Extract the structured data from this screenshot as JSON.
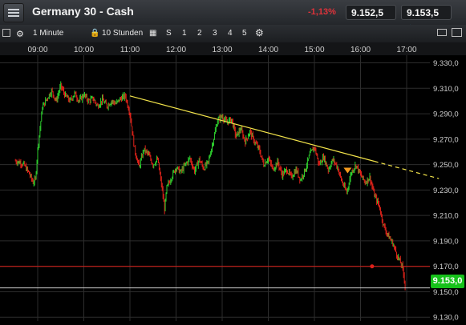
{
  "header": {
    "title": "Germany 30 - Cash",
    "change": "-1,13%",
    "sell_price": "9.152,5",
    "buy_price": "9.153,5"
  },
  "toolbar": {
    "interval": "1 Minute",
    "range": "10 Stunden",
    "s_label": "S",
    "presets": [
      "1",
      "2",
      "3",
      "4",
      "5"
    ]
  },
  "current_price": "9.153,0",
  "chart_data": {
    "type": "candlestick",
    "x_tick_labels": [
      "09:00",
      "10:00",
      "11:00",
      "12:00",
      "13:00",
      "14:00",
      "15:00",
      "16:00",
      "17:00"
    ],
    "y_tick_labels": [
      "9.330,0",
      "9.310,0",
      "9.290,0",
      "9.270,0",
      "9.250,0",
      "9.230,0",
      "9.210,0",
      "9.190,0",
      "9.170,0",
      "9.150,0",
      "9.130,0"
    ],
    "y_ticks": [
      9330,
      9310,
      9290,
      9270,
      9250,
      9230,
      9210,
      9190,
      9170,
      9150,
      9130
    ],
    "ylim": [
      9127,
      9336
    ],
    "x_hours": [
      9,
      10,
      11,
      12,
      13,
      14,
      15,
      16,
      17
    ],
    "price_path": [
      [
        8.5,
        9253
      ],
      [
        8.6,
        9252
      ],
      [
        8.7,
        9250
      ],
      [
        8.8,
        9244
      ],
      [
        8.9,
        9236
      ],
      [
        8.95,
        9238
      ],
      [
        9.0,
        9262
      ],
      [
        9.1,
        9295
      ],
      [
        9.2,
        9302
      ],
      [
        9.3,
        9308
      ],
      [
        9.4,
        9300
      ],
      [
        9.5,
        9312
      ],
      [
        9.6,
        9304
      ],
      [
        9.7,
        9300
      ],
      [
        9.8,
        9306
      ],
      [
        9.9,
        9300
      ],
      [
        10.0,
        9305
      ],
      [
        10.1,
        9300
      ],
      [
        10.2,
        9302
      ],
      [
        10.3,
        9296
      ],
      [
        10.4,
        9301
      ],
      [
        10.5,
        9296
      ],
      [
        10.6,
        9300
      ],
      [
        10.7,
        9298
      ],
      [
        10.8,
        9302
      ],
      [
        10.9,
        9304
      ],
      [
        11.0,
        9290
      ],
      [
        11.1,
        9262
      ],
      [
        11.2,
        9248
      ],
      [
        11.3,
        9262
      ],
      [
        11.4,
        9258
      ],
      [
        11.5,
        9250
      ],
      [
        11.6,
        9254
      ],
      [
        11.7,
        9230
      ],
      [
        11.75,
        9215
      ],
      [
        11.8,
        9232
      ],
      [
        11.9,
        9240
      ],
      [
        12.0,
        9248
      ],
      [
        12.1,
        9244
      ],
      [
        12.2,
        9250
      ],
      [
        12.3,
        9255
      ],
      [
        12.4,
        9245
      ],
      [
        12.5,
        9254
      ],
      [
        12.6,
        9247
      ],
      [
        12.7,
        9252
      ],
      [
        12.8,
        9268
      ],
      [
        12.9,
        9285
      ],
      [
        13.0,
        9288
      ],
      [
        13.1,
        9283
      ],
      [
        13.2,
        9286
      ],
      [
        13.3,
        9272
      ],
      [
        13.4,
        9278
      ],
      [
        13.5,
        9268
      ],
      [
        13.6,
        9276
      ],
      [
        13.7,
        9268
      ],
      [
        13.8,
        9262
      ],
      [
        13.9,
        9250
      ],
      [
        14.0,
        9255
      ],
      [
        14.1,
        9246
      ],
      [
        14.2,
        9252
      ],
      [
        14.3,
        9242
      ],
      [
        14.4,
        9246
      ],
      [
        14.5,
        9240
      ],
      [
        14.6,
        9246
      ],
      [
        14.7,
        9238
      ],
      [
        14.8,
        9246
      ],
      [
        14.9,
        9258
      ],
      [
        15.0,
        9264
      ],
      [
        15.1,
        9250
      ],
      [
        15.2,
        9256
      ],
      [
        15.3,
        9246
      ],
      [
        15.4,
        9254
      ],
      [
        15.5,
        9248
      ],
      [
        15.6,
        9236
      ],
      [
        15.7,
        9228
      ],
      [
        15.8,
        9244
      ],
      [
        15.9,
        9250
      ],
      [
        16.0,
        9242
      ],
      [
        16.1,
        9236
      ],
      [
        16.2,
        9240
      ],
      [
        16.3,
        9226
      ],
      [
        16.4,
        9218
      ],
      [
        16.5,
        9202
      ],
      [
        16.6,
        9194
      ],
      [
        16.7,
        9188
      ],
      [
        16.8,
        9178
      ],
      [
        16.9,
        9170
      ],
      [
        16.95,
        9160
      ],
      [
        16.97,
        9153
      ]
    ],
    "trendline": {
      "start": [
        11.0,
        9304
      ],
      "end": [
        17.7,
        9239
      ],
      "solid_until": 16.3
    },
    "support_line": 9170,
    "marker": {
      "x": 16.25,
      "y": 9170
    },
    "current_line": 9153,
    "entry_marker": {
      "x": 15.72,
      "y": 9245
    }
  },
  "colors": {
    "up_candle": "#2ed12e",
    "down_candle": "#e2231a",
    "trendline": "#f2e34a",
    "support_line": "#e0201a",
    "current_badge": "#16c11a",
    "grid": "#2d2d2d",
    "marker": "#f39a1e"
  },
  "icons": {
    "menu": "hamburger-icon",
    "chart_type": "chart-type-icon",
    "settings": "gear-icon",
    "lock": "lock-icon",
    "calendar": "calendar-icon",
    "screen": "window-icon",
    "fullscreen": "fullscreen-icon"
  }
}
